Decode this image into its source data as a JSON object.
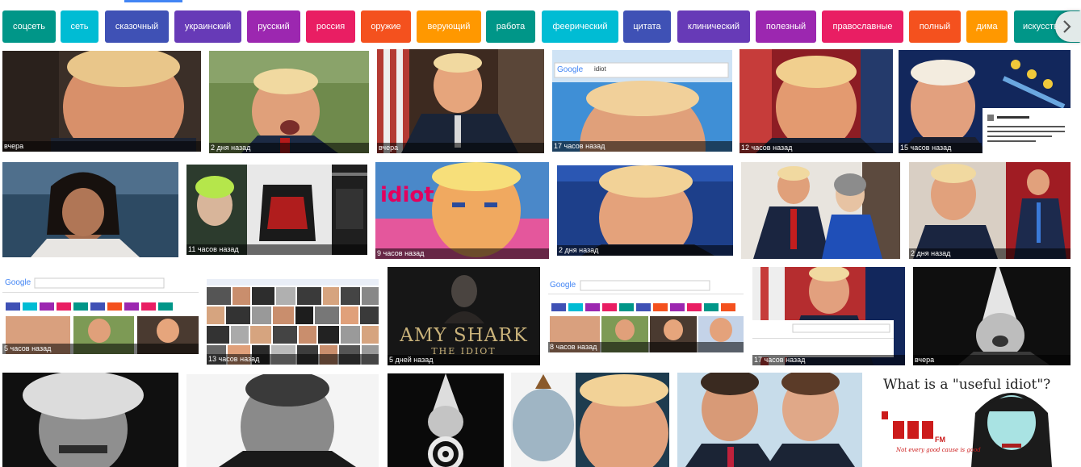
{
  "chips": [
    {
      "label": "соцсеть",
      "color": "#009688"
    },
    {
      "label": "сеть",
      "color": "#00bcd4"
    },
    {
      "label": "сказочный",
      "color": "#3f51b5"
    },
    {
      "label": "украинский",
      "color": "#673ab7"
    },
    {
      "label": "русский",
      "color": "#9c27b0"
    },
    {
      "label": "россия",
      "color": "#e91e63"
    },
    {
      "label": "оружие",
      "color": "#f4511e"
    },
    {
      "label": "верующий",
      "color": "#ff9800"
    },
    {
      "label": "работа",
      "color": "#009688"
    },
    {
      "label": "феерический",
      "color": "#00bcd4"
    },
    {
      "label": "цитата",
      "color": "#3f51b5"
    },
    {
      "label": "клинический",
      "color": "#673ab7"
    },
    {
      "label": "полезный",
      "color": "#9c27b0"
    },
    {
      "label": "православные",
      "color": "#e91e63"
    },
    {
      "label": "полный",
      "color": "#f4511e"
    },
    {
      "label": "дима",
      "color": "#ff9800"
    },
    {
      "label": "искусство",
      "color": "#009688"
    }
  ],
  "next_icon": "chevron-right-icon",
  "images": [
    {
      "caption": "вчера"
    },
    {
      "caption": "2 дня назад"
    },
    {
      "caption": "вчера"
    },
    {
      "caption": "17 часов назад",
      "logo": "Google",
      "query": "idiot"
    },
    {
      "caption": "12 часов назад"
    },
    {
      "caption": "15 часов назад"
    },
    {
      "caption": ""
    },
    {
      "caption": "11 часов назад"
    },
    {
      "caption": "9 часов назад",
      "word": "idiot"
    },
    {
      "caption": "2 дня назад"
    },
    {
      "caption": ""
    },
    {
      "caption": "2 дня назад"
    },
    {
      "caption": "5 часов назад",
      "logo": "Google"
    },
    {
      "caption": "13 часов назад"
    },
    {
      "caption": "5 дней назад",
      "title": "AMY SHARK",
      "subtitle": "THE IDIOT"
    },
    {
      "caption": "8 часов назад",
      "logo": "Google"
    },
    {
      "caption": "17 часов назад"
    },
    {
      "caption": "вчера"
    },
    {
      "caption": ""
    },
    {
      "caption": ""
    },
    {
      "caption": ""
    },
    {
      "caption": ""
    },
    {
      "caption": ""
    },
    {
      "caption": "",
      "headline": "What is a \"useful idiot\"?",
      "brand": "FM",
      "tagline": "Not every good cause is good"
    }
  ]
}
